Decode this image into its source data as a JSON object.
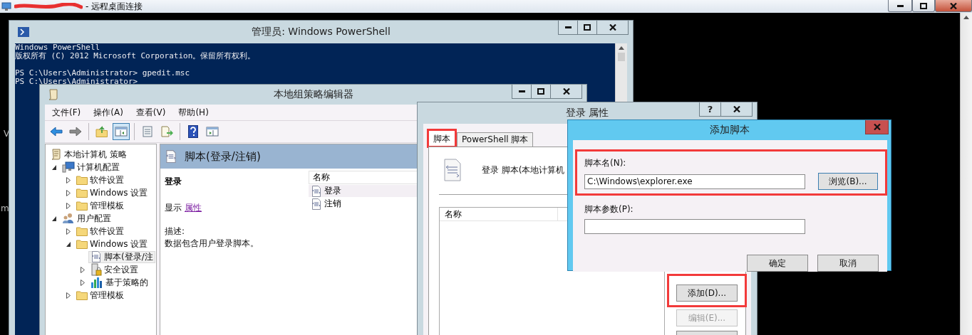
{
  "remote_desktop": {
    "title": "- 远程桌面连接",
    "redacted": true
  },
  "desktop_fragments": [
    "V",
    "m"
  ],
  "powershell": {
    "title": "管理员: Windows PowerShell",
    "blocks": [
      [
        "Windows PowerShell",
        "版权所有 (C) 2012 Microsoft Corporation。保留所有权利。"
      ],
      [
        "PS C:\\Users\\Administrator> gpedit.msc",
        "PS C:\\Users\\Administrator>"
      ]
    ]
  },
  "gpedit": {
    "title": "本地组策略编辑器",
    "menu": [
      "文件(F)",
      "操作(A)",
      "查看(V)",
      "帮助(H)"
    ],
    "toolbar": [
      {
        "kind": "back",
        "selected": false
      },
      {
        "kind": "forward",
        "selected": false
      },
      {
        "kind": "separator"
      },
      {
        "kind": "up",
        "selected": false
      },
      {
        "kind": "tree",
        "selected": true
      },
      {
        "kind": "separator"
      },
      {
        "kind": "properties",
        "selected": false
      },
      {
        "kind": "export",
        "selected": false
      },
      {
        "kind": "separator"
      },
      {
        "kind": "help",
        "selected": false
      },
      {
        "kind": "view",
        "selected": false
      }
    ],
    "tree": [
      {
        "label": "本地计算机 策略",
        "kind": "scroll",
        "selected": false,
        "children": [
          {
            "label": "计算机配置",
            "kind": "computer",
            "expanded": true,
            "selected": false,
            "children": [
              {
                "label": "软件设置",
                "kind": "folder",
                "expanded": false,
                "selected": false
              },
              {
                "label": "Windows 设置",
                "kind": "folder",
                "expanded": false,
                "selected": false
              },
              {
                "label": "管理模板",
                "kind": "folder",
                "expanded": false,
                "selected": false
              }
            ]
          },
          {
            "label": "用户配置",
            "kind": "user",
            "expanded": true,
            "selected": false,
            "children": [
              {
                "label": "软件设置",
                "kind": "folder",
                "expanded": false,
                "selected": false
              },
              {
                "label": "Windows 设置",
                "kind": "folder",
                "expanded": true,
                "selected": false,
                "children": [
                  {
                    "label": "脚本(登录/注",
                    "kind": "script",
                    "selected": true
                  },
                  {
                    "label": "安全设置",
                    "kind": "security",
                    "expanded": false,
                    "selected": false
                  },
                  {
                    "label": "基于策略的",
                    "kind": "chart",
                    "expanded": false,
                    "selected": false
                  }
                ]
              },
              {
                "label": "管理模板",
                "kind": "folder",
                "expanded": false,
                "selected": false
              }
            ]
          }
        ]
      }
    ],
    "detail": {
      "heading": "脚本(登录/注销)",
      "section": "登录",
      "show_label": "显示",
      "show_link": "属性",
      "description_label": "描述:",
      "description": "数据包含用户登录脚本。",
      "column": "名称",
      "items": [
        {
          "name": "登录",
          "selected": true
        },
        {
          "name": "注销",
          "selected": false
        }
      ]
    }
  },
  "properties": {
    "title": "登录 属性",
    "help": "?",
    "tabs": [
      {
        "label": "脚本",
        "selected": true,
        "highlighted": true
      },
      {
        "label": "PowerShell 脚本",
        "selected": false,
        "highlighted": false
      }
    ],
    "header_text": "登录 脚本(本地计算机",
    "columns": [
      "名称"
    ],
    "buttons": [
      {
        "label": "添加(D)...",
        "disabled": false,
        "highlighted": true
      },
      {
        "label": "编辑(E)...",
        "disabled": true,
        "highlighted": false
      },
      {
        "disabled": false,
        "highlighted": false
      }
    ]
  },
  "add_script": {
    "title": "添加脚本",
    "name_label": "脚本名(N):",
    "name_value": "C:\\Windows\\explorer.exe",
    "browse": "浏览(B)...",
    "name_group_highlighted": true,
    "params_label": "脚本参数(P):",
    "ok": "确定",
    "cancel": "取消"
  }
}
